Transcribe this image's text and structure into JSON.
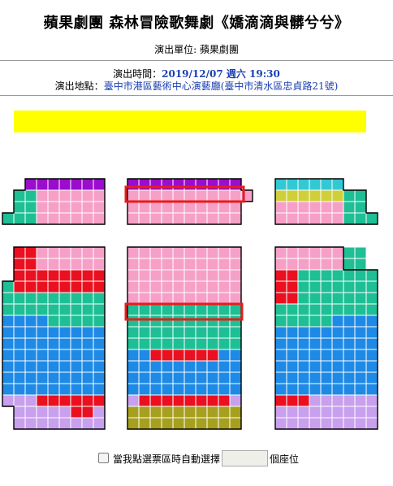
{
  "header": {
    "title": "蘋果劇團 森林冒險歌舞劇《嬌滴滴與髒兮兮》",
    "org": "演出單位: 蘋果劇團",
    "time_label": "演出時間：",
    "time_value": "2019/12/07 週六 19:30",
    "place_label": "演出地點：",
    "place_value": "臺中市港區藝術中心演藝廳(臺中市清水區忠貞路21號)"
  },
  "colors": {
    "purple": "#9a0dcc",
    "teal": "#1ebf95",
    "pink": "#f6a0c8",
    "red": "#ea1020",
    "blue": "#1e8ae6",
    "lavender": "#c8a0ee",
    "olive": "#a7a01e",
    "yellowgreen": "#cfcf3a",
    "cyan": "#33c9d4",
    "stage": "#ffff00",
    "highlight": "#e81c1c"
  },
  "footer": {
    "checkbox_label": "當我點選票區時自動選擇",
    "suffix": "個座位",
    "qty_value": ""
  }
}
